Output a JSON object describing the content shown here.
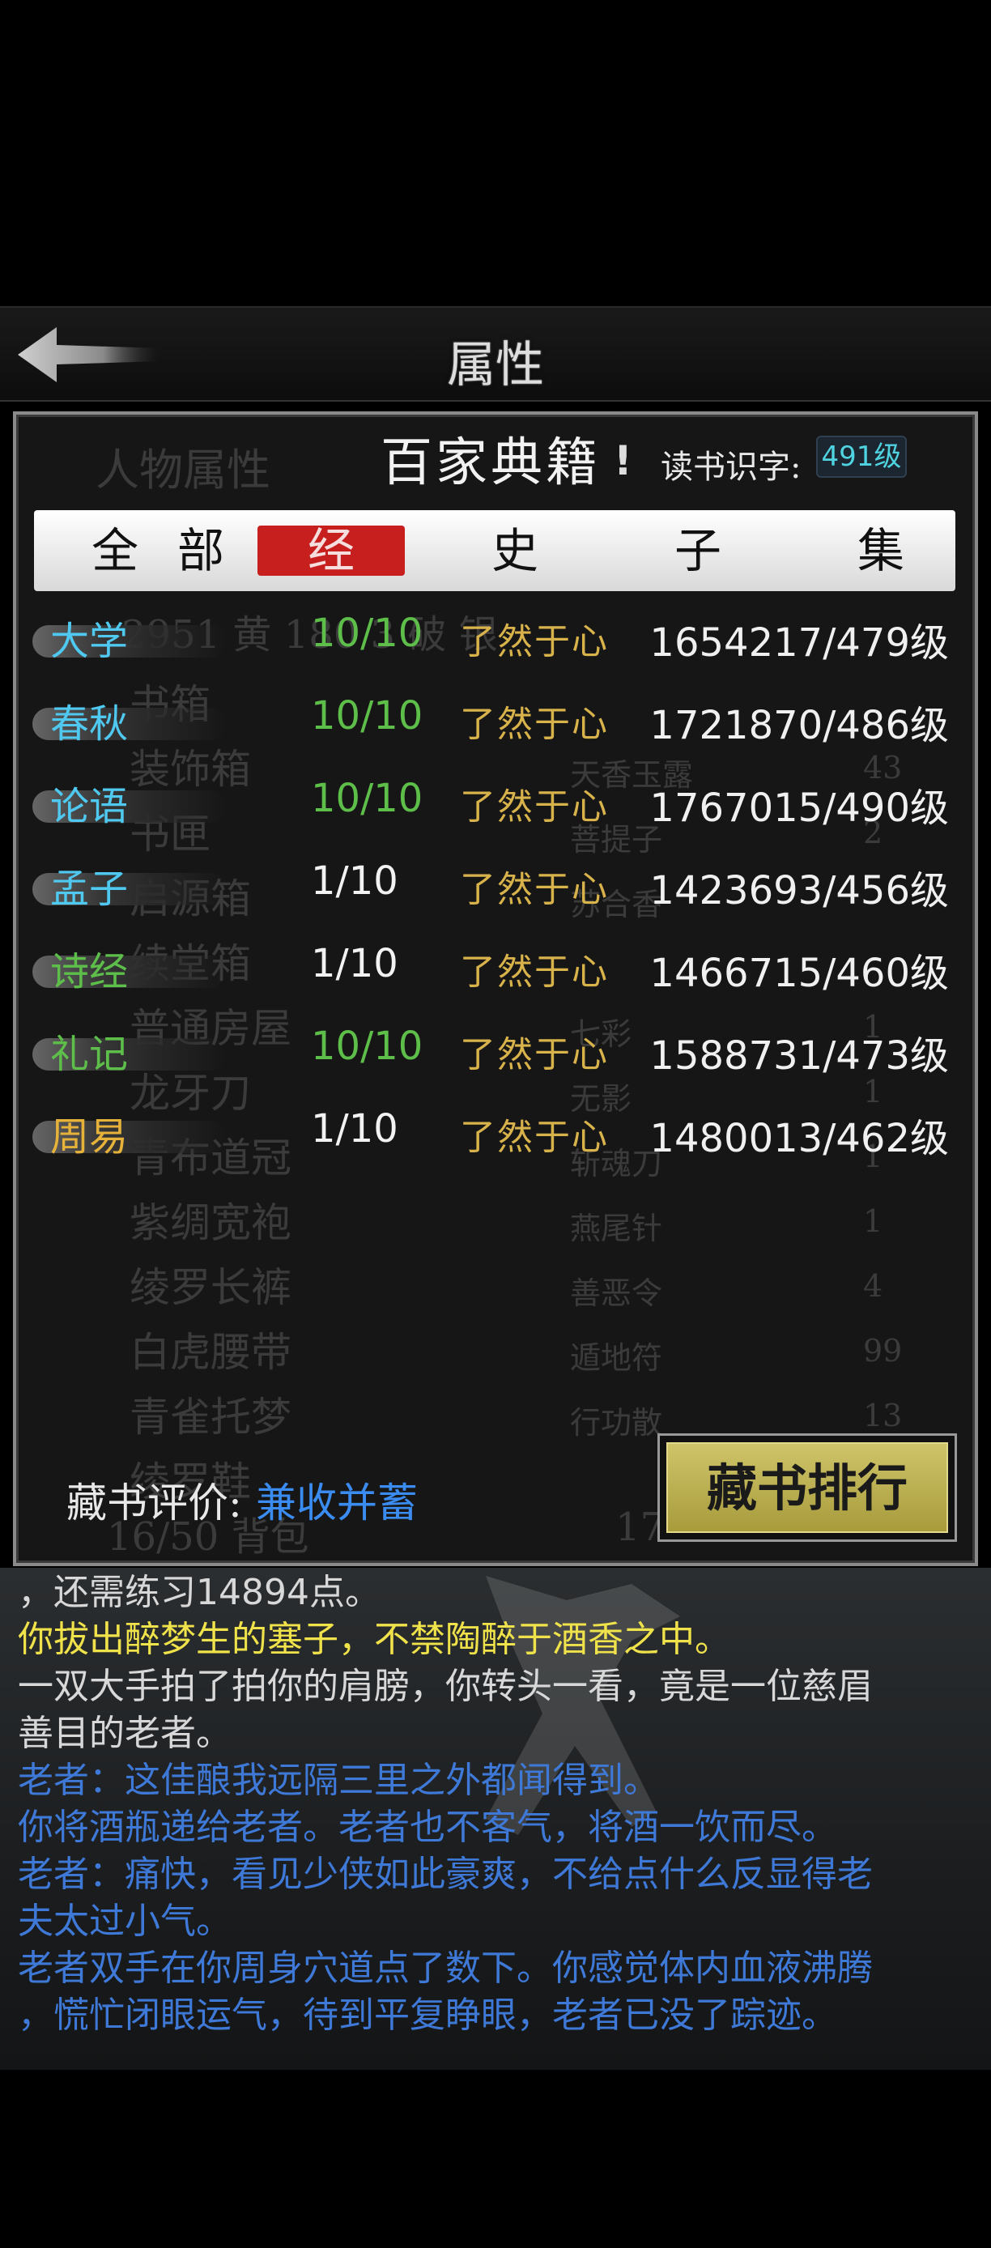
{
  "header": {
    "title": "属性"
  },
  "background_ghost": {
    "panel_label": "人物属性",
    "stats_line": "2951 黄 180 3 破 银",
    "left_items": [
      "书箱",
      "装饰箱",
      "书匣",
      "启源箱",
      "续堂箱",
      "普通房屋",
      "龙牙刀",
      "青布道冠",
      "紫绸宽袍",
      "绫罗长裤",
      "白虎腰带",
      "青雀托梦",
      "绫罗鞋"
    ],
    "right_items": [
      "天香玉露",
      "菩提子",
      "苏合香",
      "",
      "七彩",
      "无影",
      "斩魂刀",
      "燕尾针",
      "善恶令",
      "遁地符",
      "行功散"
    ],
    "right_counts": [
      "43",
      "2",
      "",
      "",
      "1",
      "1",
      "1",
      "1",
      "4",
      "99",
      "13"
    ],
    "bag": "16/50 背包",
    "bottom_num": "17"
  },
  "library": {
    "title": "百家典籍",
    "level_label": "读书识字:",
    "level_value": "491级",
    "tabs": [
      {
        "label": "全"
      },
      {
        "label": "部"
      },
      {
        "label": "经",
        "active": true
      },
      {
        "label": "史"
      },
      {
        "label": "子"
      },
      {
        "label": "集"
      }
    ],
    "books": [
      {
        "name": "大学",
        "name_color": "#4fc9f0",
        "progress": "10/10",
        "progress_color": "#5dbf4a",
        "status": "了然于心",
        "exp": "1654217/479级"
      },
      {
        "name": "春秋",
        "name_color": "#4fc9f0",
        "progress": "10/10",
        "progress_color": "#5dbf4a",
        "status": "了然于心",
        "exp": "1721870/486级"
      },
      {
        "name": "论语",
        "name_color": "#4fc9f0",
        "progress": "10/10",
        "progress_color": "#5dbf4a",
        "status": "了然于心",
        "exp": "1767015/490级"
      },
      {
        "name": "孟子",
        "name_color": "#4fc9f0",
        "progress": "1/10",
        "progress_color": "#f2f2f2",
        "status": "了然于心",
        "exp": "1423693/456级"
      },
      {
        "name": "诗经",
        "name_color": "#5dbf4a",
        "progress": "1/10",
        "progress_color": "#f2f2f2",
        "status": "了然于心",
        "exp": "1466715/460级"
      },
      {
        "name": "礼记",
        "name_color": "#5dbf4a",
        "progress": "10/10",
        "progress_color": "#5dbf4a",
        "status": "了然于心",
        "exp": "1588731/473级"
      },
      {
        "name": "周易",
        "name_color": "#e6b23a",
        "progress": "1/10",
        "progress_color": "#f2f2f2",
        "status": "了然于心",
        "exp": "1480013/462级"
      }
    ],
    "evaluation_label": "藏书评价:",
    "evaluation_value": "兼收并蓄",
    "rank_button": "藏书排行"
  },
  "log": [
    {
      "text": "，还需练习14894点。",
      "color": "#d8d8d8"
    },
    {
      "text": "你拔出醉梦生的塞子，不禁陶醉于酒香之中。",
      "color": "#f0e24a"
    },
    {
      "text": "一双大手拍了拍你的肩膀，你转头一看，竟是一位慈眉",
      "color": "#d8d8d8"
    },
    {
      "text": "善目的老者。",
      "color": "#d8d8d8"
    },
    {
      "text": "老者：这佳酿我远隔三里之外都闻得到。",
      "color": "#3f79d8"
    },
    {
      "text": "你将酒瓶递给老者。老者也不客气，将酒一饮而尽。",
      "color": "#3f79d8"
    },
    {
      "text": "老者：痛快，看见少侠如此豪爽，不给点什么反显得老",
      "color": "#3f79d8"
    },
    {
      "text": "夫太过小气。",
      "color": "#3f79d8"
    },
    {
      "text": "老者双手在你周身穴道点了数下。你感觉体内血液沸腾",
      "color": "#3f79d8"
    },
    {
      "text": "，慌忙闭眼运气，待到平复睁眼，老者已没了踪迹。",
      "color": "#3f79d8"
    }
  ]
}
